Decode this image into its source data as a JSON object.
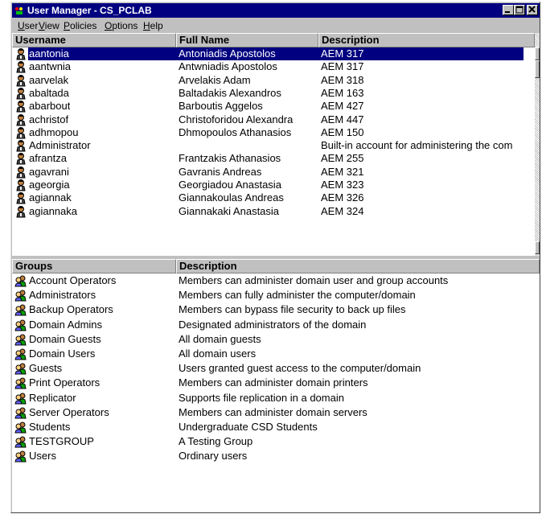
{
  "window": {
    "title": "User Manager - CS_PCLAB",
    "titlebar_color": "#000080",
    "buttons": [
      "minimize-icon",
      "maximize-icon",
      "close-icon"
    ]
  },
  "menu": [
    {
      "label": "User",
      "underline": "U",
      "rest": "ser"
    },
    {
      "label": "View",
      "underline": "V",
      "rest": "iew"
    },
    {
      "label": "Policies",
      "underline": "P",
      "rest": "olicies"
    },
    {
      "label": "Options",
      "underline": "O",
      "rest": "ptions"
    },
    {
      "label": "Help",
      "underline": "H",
      "rest": "elp"
    }
  ],
  "users_table": {
    "columns": [
      "Username",
      "Full Name",
      "Description"
    ],
    "rows": [
      {
        "username": "aantonia",
        "full_name": "Antoniadis Apostolos",
        "description": "AEM 317",
        "selected": true
      },
      {
        "username": "aantwnia",
        "full_name": "Antwniadis Apostolos",
        "description": "AEM 317"
      },
      {
        "username": "aarvelak",
        "full_name": "Arvelakis Adam",
        "description": "AEM 318"
      },
      {
        "username": "abaltada",
        "full_name": "Baltadakis Alexandros",
        "description": "AEM 163"
      },
      {
        "username": "abarbout",
        "full_name": "Barboutis Aggelos",
        "description": "AEM 427"
      },
      {
        "username": "achristof",
        "full_name": "Christoforidou Alexandra",
        "description": "AEM 447"
      },
      {
        "username": "adhmopou",
        "full_name": "Dhmopoulos Athanasios",
        "description": "AEM 150"
      },
      {
        "username": "Administrator",
        "full_name": "",
        "description": "Built-in account for administering the com"
      },
      {
        "username": "afrantza",
        "full_name": "Frantzakis Athanasios",
        "description": "AEM 255"
      },
      {
        "username": "agavrani",
        "full_name": "Gavranis Andreas",
        "description": "AEM 321"
      },
      {
        "username": "ageorgia",
        "full_name": "Georgiadou Anastasia",
        "description": "AEM 323"
      },
      {
        "username": "agiannak",
        "full_name": "Giannakoulas Andreas",
        "description": "AEM 326"
      },
      {
        "username": "agiannaka",
        "full_name": "Giannakaki Anastasia",
        "description": "AEM 324"
      }
    ]
  },
  "groups_table": {
    "columns": [
      "Groups",
      "Description"
    ],
    "rows": [
      {
        "name": "Account Operators",
        "description": "Members can administer domain user and group accounts"
      },
      {
        "name": "Administrators",
        "description": "Members can fully administer the computer/domain"
      },
      {
        "name": "Backup Operators",
        "description": "Members can bypass file security to back up files"
      },
      {
        "name": "Domain Admins",
        "description": "Designated administrators of the domain"
      },
      {
        "name": "Domain Guests",
        "description": "All domain guests"
      },
      {
        "name": "Domain Users",
        "description": "All domain users"
      },
      {
        "name": "Guests",
        "description": "Users granted guest access to the computer/domain"
      },
      {
        "name": "Print Operators",
        "description": "Members can administer domain printers"
      },
      {
        "name": "Replicator",
        "description": "Supports file replication in a domain"
      },
      {
        "name": "Server Operators",
        "description": "Members can administer domain servers"
      },
      {
        "name": "Students",
        "description": "Undergraduate CSD Students"
      },
      {
        "name": "TESTGROUP",
        "description": "A Testing Group"
      },
      {
        "name": "Users",
        "description": "Ordinary users"
      }
    ]
  },
  "colors": {
    "selection_bg": "#000080",
    "face": "#c0c0c0"
  }
}
